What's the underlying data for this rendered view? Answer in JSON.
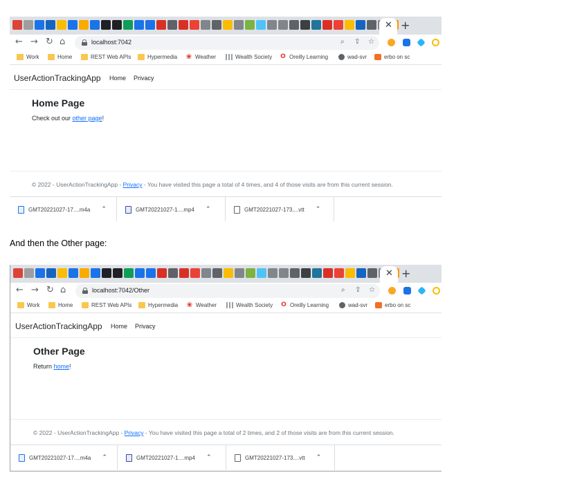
{
  "caption": "And then the Other page:",
  "favicon_colors": [
    "#db4437",
    "#9e9e9e",
    "#1a73e8",
    "#1565c0",
    "#fbbc04",
    "#1a73e8",
    "#f9ab00",
    "#1a73e8",
    "#202124",
    "#202124",
    "#0f9d58",
    "#1a73e8",
    "#1a73e8",
    "#d93025",
    "#5f6368",
    "#d93025",
    "#ea4335",
    "#80868b",
    "#5f6368",
    "#fbbc04",
    "#80868b",
    "#7cb342",
    "#4fc3f7",
    "#80868b",
    "#80868b",
    "#5f6368",
    "#3c4043",
    "#21759b",
    "#d93025",
    "#ea4335",
    "#fbbc04",
    "#1565c0",
    "#5f6368",
    "#80868b",
    "#ff9800"
  ],
  "bookmarks": [
    {
      "label": "Work",
      "icon": "folder-icon"
    },
    {
      "label": "Home",
      "icon": "folder-icon"
    },
    {
      "label": "REST Web APIs",
      "icon": "folder-icon"
    },
    {
      "label": "Hypermedia",
      "icon": "folder-icon"
    },
    {
      "label": "Weather",
      "icon": "maple-leaf-icon"
    },
    {
      "label": "Wealth Society",
      "icon": "bars-icon"
    },
    {
      "label": "Oreilly Learning",
      "icon": "opera-icon"
    },
    {
      "label": "wad-svr",
      "icon": "globe-icon"
    },
    {
      "label": "erbo on sc",
      "icon": "soundcloud-icon"
    }
  ],
  "downloads": [
    {
      "name": "GMT20221027-17....m4a",
      "icon": "audio-file-icon"
    },
    {
      "name": "GMT20221027-1....mp4",
      "icon": "video-file-icon"
    },
    {
      "name": "GMT20221027-173....vtt",
      "icon": "text-file-icon"
    }
  ],
  "screenshots": [
    {
      "url": "localhost:7042",
      "brand": "UserActionTrackingApp",
      "nav": [
        "Home",
        "Privacy"
      ],
      "heading": "Home Page",
      "text_before": "Check out our ",
      "link": "other page",
      "text_after": "!",
      "footer_prefix": "© 2022 - UserActionTrackingApp - ",
      "footer_link": "Privacy",
      "footer_suffix": " - You have visited this page a total of 4 times, and 4 of those visits are from this current session."
    },
    {
      "url": "localhost:7042/Other",
      "brand": "UserActionTrackingApp",
      "nav": [
        "Home",
        "Privacy"
      ],
      "heading": "Other Page",
      "text_before": "Return ",
      "link": "home",
      "text_after": "!",
      "footer_prefix": "© 2022 - UserActionTrackingApp - ",
      "footer_link": "Privacy",
      "footer_suffix": " - You have visited this page a total of 2 times, and 2 of those visits are from this current session."
    }
  ]
}
